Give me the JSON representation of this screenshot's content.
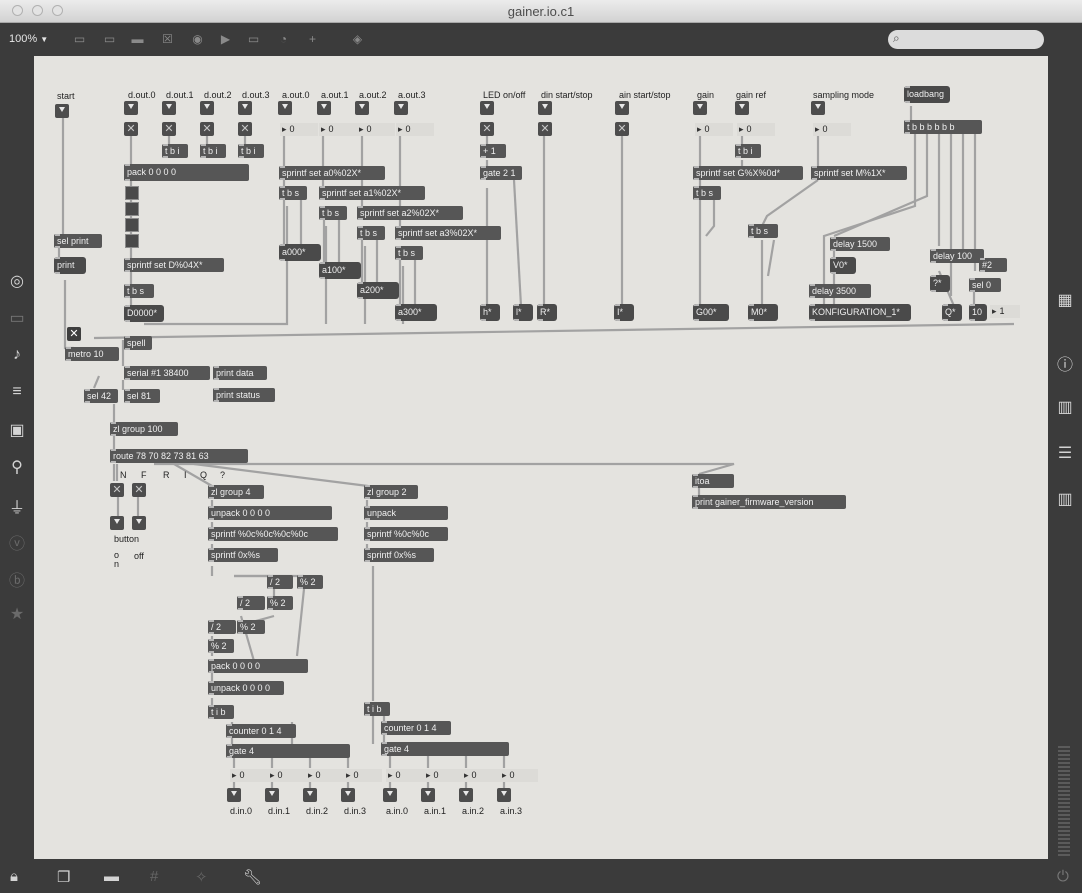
{
  "window": {
    "title": "gainer.io.c1"
  },
  "toolbar": {
    "zoom": "100%",
    "zoom_arrow": "▼"
  },
  "patch": {
    "comments": {
      "start": "start",
      "dout0": "d.out.0",
      "dout1": "d.out.1",
      "dout2": "d.out.2",
      "dout3": "d.out.3",
      "aout0": "a.out.0",
      "aout1": "a.out.1",
      "aout2": "a.out.2",
      "aout3": "a.out.3",
      "led": "LED on/off",
      "din": "din start/stop",
      "ain": "ain start/stop",
      "gain": "gain",
      "gainref": "gain ref",
      "sampling": "sampling mode",
      "N": "N",
      "F": "F",
      "R": "R",
      "I": "I",
      "Q": "Q",
      "qm": "?",
      "button": "button",
      "on": "o\nn",
      "off": "off",
      "din0": "d.in.0",
      "din1": "d.in.1",
      "din2": "d.in.2",
      "din3": "d.in.3",
      "ain0": "a.in.0",
      "ain1": "a.in.1",
      "ain2": "a.in.2",
      "ain3": "a.in.3"
    },
    "objects": {
      "pack4": "pack 0 0 0 0",
      "tbi1": "t b i",
      "tbi2": "t b i",
      "tbi3": "t b i",
      "sprintfD": "sprintf set D%04X*",
      "tbsD": "t b s",
      "msgD": "D0000*",
      "selprint": "sel print",
      "print": "print",
      "sa0": "sprintf set a0%02X*",
      "sa1": "sprintf set a1%02X*",
      "sa2": "sprintf set a2%02X*",
      "sa3": "sprintf set a3%02X*",
      "tbs0": "t b s",
      "tbs1": "t b s",
      "tbs2": "t b s",
      "tbs3": "t b s",
      "msga0": "a000*",
      "msga1": "a100*",
      "msga2": "a200*",
      "msga3": "a300*",
      "plus1": "+ 1",
      "gate21": "gate 2 1",
      "msgh": "h*",
      "msgl": "l*",
      "msgR": "R*",
      "msgI": "I*",
      "sgain": "sprintf set G%X%0d*",
      "tbsg": "t b s",
      "tbig": "t b i",
      "msgG": "G00*",
      "tbsM": "t b s",
      "msgM": "M0*",
      "sM": "sprintf set M%1X*",
      "loadbang": "loadbang",
      "tbbb": "t b b b b b b",
      "delay1500": "delay 1500",
      "msgV": "V0*",
      "delay3500": "delay 3500",
      "msgK": "KONFIGURATION_1*",
      "delay100": "delay 100",
      "s2": "#2",
      "msgq": "?*",
      "sel0": "sel 0",
      "msgQ": "Q*",
      "msg10": "10",
      "metro": "metro 10",
      "spell": "spell",
      "serial": "serial #1 38400",
      "printdata": "print data",
      "printstatus": "print status",
      "sel42": "sel 42",
      "sel81": "sel 81",
      "zlg100": "zl group 100",
      "route": "route 78 70 82 73 81 63",
      "itoa": "itoa",
      "printfw": "print gainer_firmware_version",
      "zlg4": "zl group 4",
      "unpack4": "unpack 0 0 0 0",
      "spr4c": "sprintf %0c%0c%0c%0c",
      "spr0x": "sprintf 0x%s",
      "zlg2": "zl group 2",
      "unpack": "unpack",
      "spr2c": "sprintf %0c%0c",
      "spr0x2": "sprintf 0x%s",
      "div2a": "/ 2",
      "mod2a": "% 2",
      "div2b": "/ 2",
      "mod2b": "% 2",
      "div2c": "/ 2",
      "mod2c": "% 2",
      "mod2d": "% 2",
      "pack40": "pack 0 0 0 0",
      "unpack40": "unpack 0 0 0 0",
      "tib1": "t i b",
      "counter1": "counter 0 1 4",
      "gate41": "gate 4",
      "tib2": "t i b",
      "counter2": "counter 0 1 4",
      "gate42": "gate 4"
    },
    "numbers": {
      "n0": "0",
      "n1": "0",
      "n2": "0",
      "n3": "0",
      "ng": "0",
      "ngr": "0",
      "nsm": "0",
      "n1r": "1",
      "o0": "0",
      "o1": "0",
      "o2": "0",
      "o3": "0",
      "o4": "0",
      "o5": "0",
      "o6": "0",
      "o7": "0"
    }
  }
}
